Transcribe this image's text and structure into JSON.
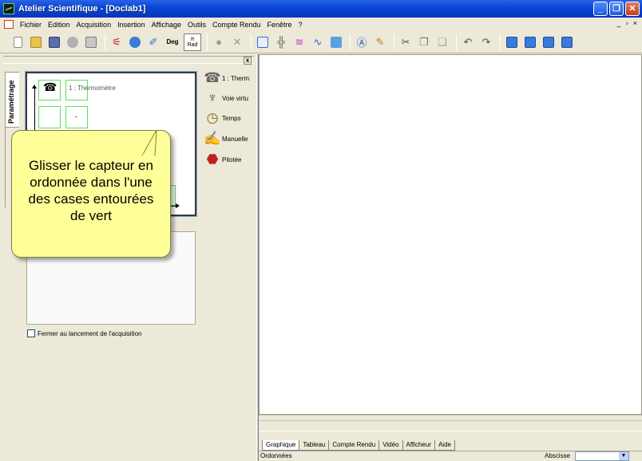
{
  "window": {
    "title": "Atelier Scientifique - [Doclab1]"
  },
  "menu": {
    "items": [
      "Fichier",
      "Edition",
      "Acquisition",
      "Insertion",
      "Affichage",
      "Outils",
      "Compte Rendu",
      "Fenêtre",
      "?"
    ],
    "mdi_controls": [
      "_",
      "▫",
      "×"
    ]
  },
  "toolbar": {
    "deg_label": "Deg",
    "rad_top": "π",
    "rad_label": "Rad"
  },
  "left_panel": {
    "vertical_tab": "Paramétrage",
    "slot_label": "1 : Thermomètre",
    "slot_mark": "-",
    "close_label": "x",
    "checkbox_label": "Fermer au lancement de l'acquisition"
  },
  "sensors": [
    {
      "label": "1 : Therm",
      "icon": "thermometer-icon"
    },
    {
      "label": "Voie virtu",
      "icon": "virtual-channel-icon"
    },
    {
      "label": "Temps",
      "icon": "clock-icon"
    },
    {
      "label": "Manuelle",
      "icon": "hand-keyboard-icon"
    },
    {
      "label": "Pilotée",
      "icon": "piloted-icon"
    }
  ],
  "callout": {
    "text": "Glisser le capteur en ordonnée dans l'une des cases entourées de vert"
  },
  "bottom_tabs": [
    "Graphique",
    "Tableau",
    "Compte Rendu",
    "Vidéo",
    "Afficheur",
    "Aide"
  ],
  "status": {
    "ordinate_label": "Ordonnées",
    "abscissa_label": "Abscisse",
    "abscissa_value": ""
  },
  "colors": {
    "titlebar": "#0a48d8",
    "callout_bg": "#ffff99",
    "slot_border": "#5ee05e"
  }
}
